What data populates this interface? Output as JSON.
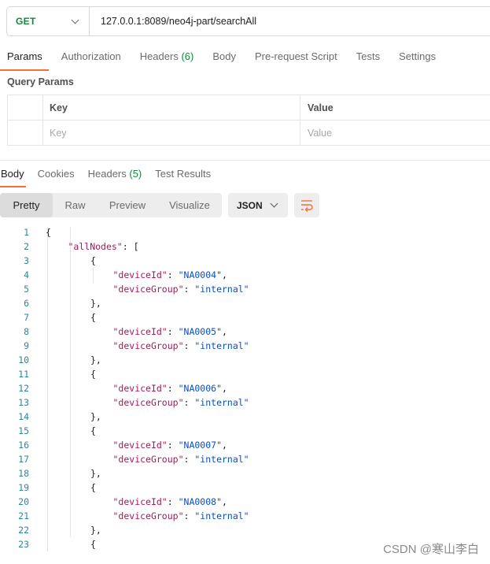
{
  "request": {
    "method": "GET",
    "url": "127.0.0.1:8089/neo4j-part/searchAll"
  },
  "request_tabs": {
    "params": "Params",
    "authorization": "Authorization",
    "headers": "Headers",
    "headers_count": "(6)",
    "body": "Body",
    "prerequest": "Pre-request Script",
    "tests": "Tests",
    "settings": "Settings"
  },
  "query_params": {
    "title": "Query Params",
    "col_key": "Key",
    "col_value": "Value",
    "key_placeholder": "Key",
    "value_placeholder": "Value"
  },
  "response_tabs": {
    "body": "Body",
    "cookies": "Cookies",
    "headers": "Headers",
    "headers_count": "(5)",
    "test_results": "Test Results"
  },
  "view_modes": {
    "pretty": "Pretty",
    "raw": "Raw",
    "preview": "Preview",
    "visualize": "Visualize"
  },
  "format": "JSON",
  "response_lines": [
    {
      "n": "1",
      "indent": 0,
      "text": "{"
    },
    {
      "n": "2",
      "indent": 1,
      "key": "\"allNodes\"",
      "text": ": ["
    },
    {
      "n": "3",
      "indent": 2,
      "text": "{"
    },
    {
      "n": "4",
      "indent": 3,
      "key": "\"deviceId\"",
      "text": ": ",
      "str": "\"NA0004\"",
      "end": ","
    },
    {
      "n": "5",
      "indent": 3,
      "key": "\"deviceGroup\"",
      "text": ": ",
      "str": "\"internal\""
    },
    {
      "n": "6",
      "indent": 2,
      "text": "},"
    },
    {
      "n": "7",
      "indent": 2,
      "text": "{"
    },
    {
      "n": "8",
      "indent": 3,
      "key": "\"deviceId\"",
      "text": ": ",
      "str": "\"NA0005\"",
      "end": ","
    },
    {
      "n": "9",
      "indent": 3,
      "key": "\"deviceGroup\"",
      "text": ": ",
      "str": "\"internal\""
    },
    {
      "n": "10",
      "indent": 2,
      "text": "},"
    },
    {
      "n": "11",
      "indent": 2,
      "text": "{"
    },
    {
      "n": "12",
      "indent": 3,
      "key": "\"deviceId\"",
      "text": ": ",
      "str": "\"NA0006\"",
      "end": ","
    },
    {
      "n": "13",
      "indent": 3,
      "key": "\"deviceGroup\"",
      "text": ": ",
      "str": "\"internal\""
    },
    {
      "n": "14",
      "indent": 2,
      "text": "},"
    },
    {
      "n": "15",
      "indent": 2,
      "text": "{"
    },
    {
      "n": "16",
      "indent": 3,
      "key": "\"deviceId\"",
      "text": ": ",
      "str": "\"NA0007\"",
      "end": ","
    },
    {
      "n": "17",
      "indent": 3,
      "key": "\"deviceGroup\"",
      "text": ": ",
      "str": "\"internal\""
    },
    {
      "n": "18",
      "indent": 2,
      "text": "},"
    },
    {
      "n": "19",
      "indent": 2,
      "text": "{"
    },
    {
      "n": "20",
      "indent": 3,
      "key": "\"deviceId\"",
      "text": ": ",
      "str": "\"NA0008\"",
      "end": ","
    },
    {
      "n": "21",
      "indent": 3,
      "key": "\"deviceGroup\"",
      "text": ": ",
      "str": "\"internal\""
    },
    {
      "n": "22",
      "indent": 2,
      "text": "},"
    },
    {
      "n": "23",
      "indent": 2,
      "text": "{"
    }
  ],
  "watermark": "CSDN @寒山李白",
  "colors": {
    "accent": "#ff6c37",
    "method_get": "#0f8a3a",
    "json_key": "#a3195b",
    "json_string": "#0a4fbf",
    "line_number": "#2a8a9c"
  }
}
